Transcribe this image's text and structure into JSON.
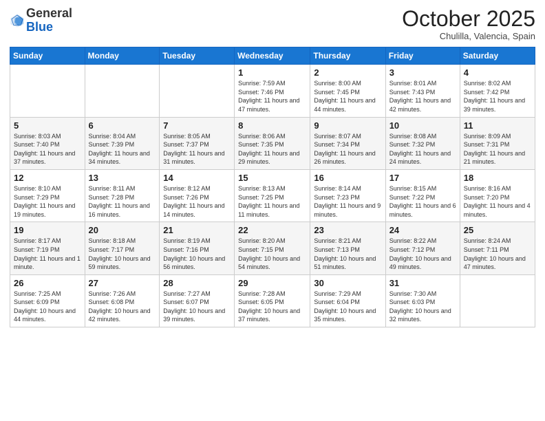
{
  "logo": {
    "general": "General",
    "blue": "Blue"
  },
  "header": {
    "month": "October 2025",
    "location": "Chulilla, Valencia, Spain"
  },
  "weekdays": [
    "Sunday",
    "Monday",
    "Tuesday",
    "Wednesday",
    "Thursday",
    "Friday",
    "Saturday"
  ],
  "weeks": [
    [
      {
        "day": "",
        "sunrise": "",
        "sunset": "",
        "daylight": ""
      },
      {
        "day": "",
        "sunrise": "",
        "sunset": "",
        "daylight": ""
      },
      {
        "day": "",
        "sunrise": "",
        "sunset": "",
        "daylight": ""
      },
      {
        "day": "1",
        "sunrise": "Sunrise: 7:59 AM",
        "sunset": "Sunset: 7:46 PM",
        "daylight": "Daylight: 11 hours and 47 minutes."
      },
      {
        "day": "2",
        "sunrise": "Sunrise: 8:00 AM",
        "sunset": "Sunset: 7:45 PM",
        "daylight": "Daylight: 11 hours and 44 minutes."
      },
      {
        "day": "3",
        "sunrise": "Sunrise: 8:01 AM",
        "sunset": "Sunset: 7:43 PM",
        "daylight": "Daylight: 11 hours and 42 minutes."
      },
      {
        "day": "4",
        "sunrise": "Sunrise: 8:02 AM",
        "sunset": "Sunset: 7:42 PM",
        "daylight": "Daylight: 11 hours and 39 minutes."
      }
    ],
    [
      {
        "day": "5",
        "sunrise": "Sunrise: 8:03 AM",
        "sunset": "Sunset: 7:40 PM",
        "daylight": "Daylight: 11 hours and 37 minutes."
      },
      {
        "day": "6",
        "sunrise": "Sunrise: 8:04 AM",
        "sunset": "Sunset: 7:39 PM",
        "daylight": "Daylight: 11 hours and 34 minutes."
      },
      {
        "day": "7",
        "sunrise": "Sunrise: 8:05 AM",
        "sunset": "Sunset: 7:37 PM",
        "daylight": "Daylight: 11 hours and 31 minutes."
      },
      {
        "day": "8",
        "sunrise": "Sunrise: 8:06 AM",
        "sunset": "Sunset: 7:35 PM",
        "daylight": "Daylight: 11 hours and 29 minutes."
      },
      {
        "day": "9",
        "sunrise": "Sunrise: 8:07 AM",
        "sunset": "Sunset: 7:34 PM",
        "daylight": "Daylight: 11 hours and 26 minutes."
      },
      {
        "day": "10",
        "sunrise": "Sunrise: 8:08 AM",
        "sunset": "Sunset: 7:32 PM",
        "daylight": "Daylight: 11 hours and 24 minutes."
      },
      {
        "day": "11",
        "sunrise": "Sunrise: 8:09 AM",
        "sunset": "Sunset: 7:31 PM",
        "daylight": "Daylight: 11 hours and 21 minutes."
      }
    ],
    [
      {
        "day": "12",
        "sunrise": "Sunrise: 8:10 AM",
        "sunset": "Sunset: 7:29 PM",
        "daylight": "Daylight: 11 hours and 19 minutes."
      },
      {
        "day": "13",
        "sunrise": "Sunrise: 8:11 AM",
        "sunset": "Sunset: 7:28 PM",
        "daylight": "Daylight: 11 hours and 16 minutes."
      },
      {
        "day": "14",
        "sunrise": "Sunrise: 8:12 AM",
        "sunset": "Sunset: 7:26 PM",
        "daylight": "Daylight: 11 hours and 14 minutes."
      },
      {
        "day": "15",
        "sunrise": "Sunrise: 8:13 AM",
        "sunset": "Sunset: 7:25 PM",
        "daylight": "Daylight: 11 hours and 11 minutes."
      },
      {
        "day": "16",
        "sunrise": "Sunrise: 8:14 AM",
        "sunset": "Sunset: 7:23 PM",
        "daylight": "Daylight: 11 hours and 9 minutes."
      },
      {
        "day": "17",
        "sunrise": "Sunrise: 8:15 AM",
        "sunset": "Sunset: 7:22 PM",
        "daylight": "Daylight: 11 hours and 6 minutes."
      },
      {
        "day": "18",
        "sunrise": "Sunrise: 8:16 AM",
        "sunset": "Sunset: 7:20 PM",
        "daylight": "Daylight: 11 hours and 4 minutes."
      }
    ],
    [
      {
        "day": "19",
        "sunrise": "Sunrise: 8:17 AM",
        "sunset": "Sunset: 7:19 PM",
        "daylight": "Daylight: 11 hours and 1 minute."
      },
      {
        "day": "20",
        "sunrise": "Sunrise: 8:18 AM",
        "sunset": "Sunset: 7:17 PM",
        "daylight": "Daylight: 10 hours and 59 minutes."
      },
      {
        "day": "21",
        "sunrise": "Sunrise: 8:19 AM",
        "sunset": "Sunset: 7:16 PM",
        "daylight": "Daylight: 10 hours and 56 minutes."
      },
      {
        "day": "22",
        "sunrise": "Sunrise: 8:20 AM",
        "sunset": "Sunset: 7:15 PM",
        "daylight": "Daylight: 10 hours and 54 minutes."
      },
      {
        "day": "23",
        "sunrise": "Sunrise: 8:21 AM",
        "sunset": "Sunset: 7:13 PM",
        "daylight": "Daylight: 10 hours and 51 minutes."
      },
      {
        "day": "24",
        "sunrise": "Sunrise: 8:22 AM",
        "sunset": "Sunset: 7:12 PM",
        "daylight": "Daylight: 10 hours and 49 minutes."
      },
      {
        "day": "25",
        "sunrise": "Sunrise: 8:24 AM",
        "sunset": "Sunset: 7:11 PM",
        "daylight": "Daylight: 10 hours and 47 minutes."
      }
    ],
    [
      {
        "day": "26",
        "sunrise": "Sunrise: 7:25 AM",
        "sunset": "Sunset: 6:09 PM",
        "daylight": "Daylight: 10 hours and 44 minutes."
      },
      {
        "day": "27",
        "sunrise": "Sunrise: 7:26 AM",
        "sunset": "Sunset: 6:08 PM",
        "daylight": "Daylight: 10 hours and 42 minutes."
      },
      {
        "day": "28",
        "sunrise": "Sunrise: 7:27 AM",
        "sunset": "Sunset: 6:07 PM",
        "daylight": "Daylight: 10 hours and 39 minutes."
      },
      {
        "day": "29",
        "sunrise": "Sunrise: 7:28 AM",
        "sunset": "Sunset: 6:05 PM",
        "daylight": "Daylight: 10 hours and 37 minutes."
      },
      {
        "day": "30",
        "sunrise": "Sunrise: 7:29 AM",
        "sunset": "Sunset: 6:04 PM",
        "daylight": "Daylight: 10 hours and 35 minutes."
      },
      {
        "day": "31",
        "sunrise": "Sunrise: 7:30 AM",
        "sunset": "Sunset: 6:03 PM",
        "daylight": "Daylight: 10 hours and 32 minutes."
      },
      {
        "day": "",
        "sunrise": "",
        "sunset": "",
        "daylight": ""
      }
    ]
  ]
}
